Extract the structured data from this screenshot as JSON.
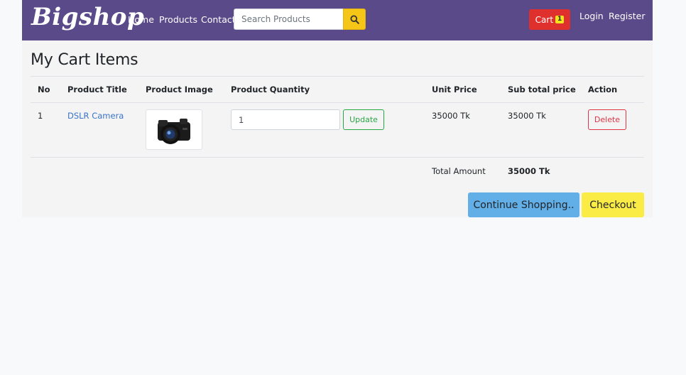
{
  "nav": {
    "logo": "Bigshop",
    "links": [
      "Home",
      "Products",
      "Contact"
    ],
    "search_placeholder": "Search Products",
    "cart_label": "Cart",
    "cart_count": "1",
    "login": "Login",
    "register": "Register"
  },
  "page": {
    "title": "My Cart Items"
  },
  "table": {
    "headers": [
      "No",
      "Product Title",
      "Product Image",
      "Product Quantity",
      "Unit Price",
      "Sub total price",
      "Action"
    ],
    "rows": [
      {
        "no": "1",
        "title": "DSLR Camera",
        "quantity": "1",
        "update_label": "Update",
        "unit_price": "35000 Tk",
        "subtotal": "35000 Tk",
        "delete_label": "Delete"
      }
    ],
    "total_label": "Total Amount",
    "total_value": "35000 Tk"
  },
  "actions": {
    "continue": "Continue Shopping..",
    "checkout": "Checkout"
  },
  "colors": {
    "navbar": "#5b4a8a",
    "cart": "#e0302d",
    "continue": "#62aee6",
    "checkout": "#fbec45"
  }
}
